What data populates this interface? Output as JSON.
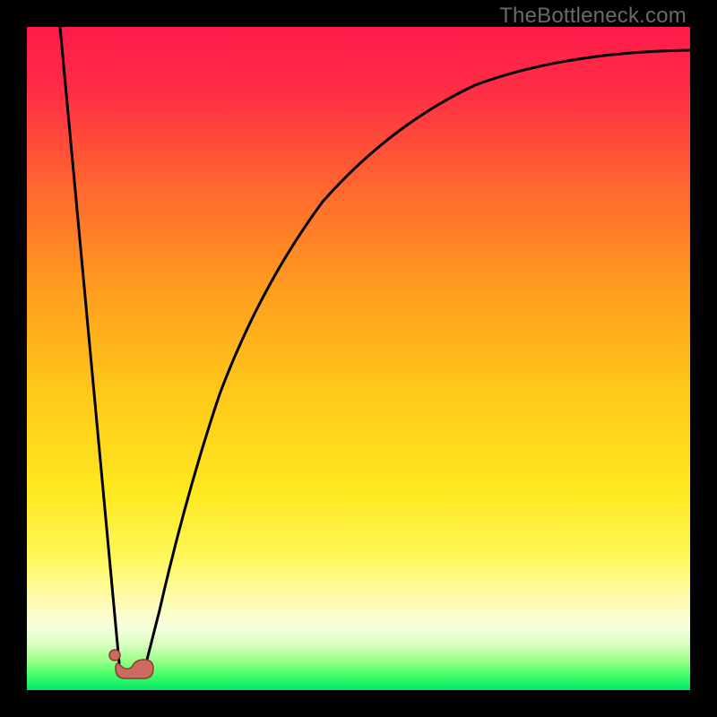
{
  "watermark": "TheBottleneck.com",
  "colors": {
    "black": "#000000",
    "curve": "#000000",
    "marker_fill": "#cb6a5e",
    "marker_stroke": "#8a3b33",
    "gradient_stops": [
      {
        "offset": 0.0,
        "color": "#ff1a4b"
      },
      {
        "offset": 0.1,
        "color": "#ff2f44"
      },
      {
        "offset": 0.25,
        "color": "#ff6a2e"
      },
      {
        "offset": 0.4,
        "color": "#ff9e1f"
      },
      {
        "offset": 0.55,
        "color": "#ffc81a"
      },
      {
        "offset": 0.7,
        "color": "#ffe81f"
      },
      {
        "offset": 0.8,
        "color": "#fff75a"
      },
      {
        "offset": 0.86,
        "color": "#fffbaa"
      },
      {
        "offset": 0.905,
        "color": "#f6ffe0"
      },
      {
        "offset": 0.93,
        "color": "#d9ffc0"
      },
      {
        "offset": 0.955,
        "color": "#9dff8a"
      },
      {
        "offset": 0.975,
        "color": "#4dff6a"
      },
      {
        "offset": 1.0,
        "color": "#00e865"
      }
    ]
  },
  "chart_data": {
    "type": "line",
    "title": "",
    "xlabel": "",
    "ylabel": "",
    "xlim": [
      0,
      100
    ],
    "ylim": [
      0,
      100
    ],
    "series": [
      {
        "name": "left-branch",
        "x": [
          5,
          6,
          7,
          8,
          9,
          10,
          11,
          12,
          13,
          14
        ],
        "y": [
          100,
          89,
          78,
          67,
          56,
          45,
          34,
          23,
          12,
          4
        ]
      },
      {
        "name": "right-branch",
        "x": [
          18,
          20,
          22,
          25,
          28,
          32,
          36,
          41,
          47,
          54,
          62,
          71,
          81,
          91,
          100
        ],
        "y": [
          4,
          12,
          22,
          33,
          44,
          54,
          62,
          70,
          77,
          83,
          88,
          91.5,
          94,
          95.5,
          96.5
        ]
      }
    ],
    "points": [
      {
        "name": "marker-dot",
        "x": 13.3,
        "y": 5.2
      }
    ],
    "shapes": [
      {
        "name": "marker-blob",
        "type": "path",
        "approx_bbox_x": [
          13,
          19
        ],
        "approx_bbox_y": [
          1.5,
          4.5
        ]
      }
    ]
  }
}
